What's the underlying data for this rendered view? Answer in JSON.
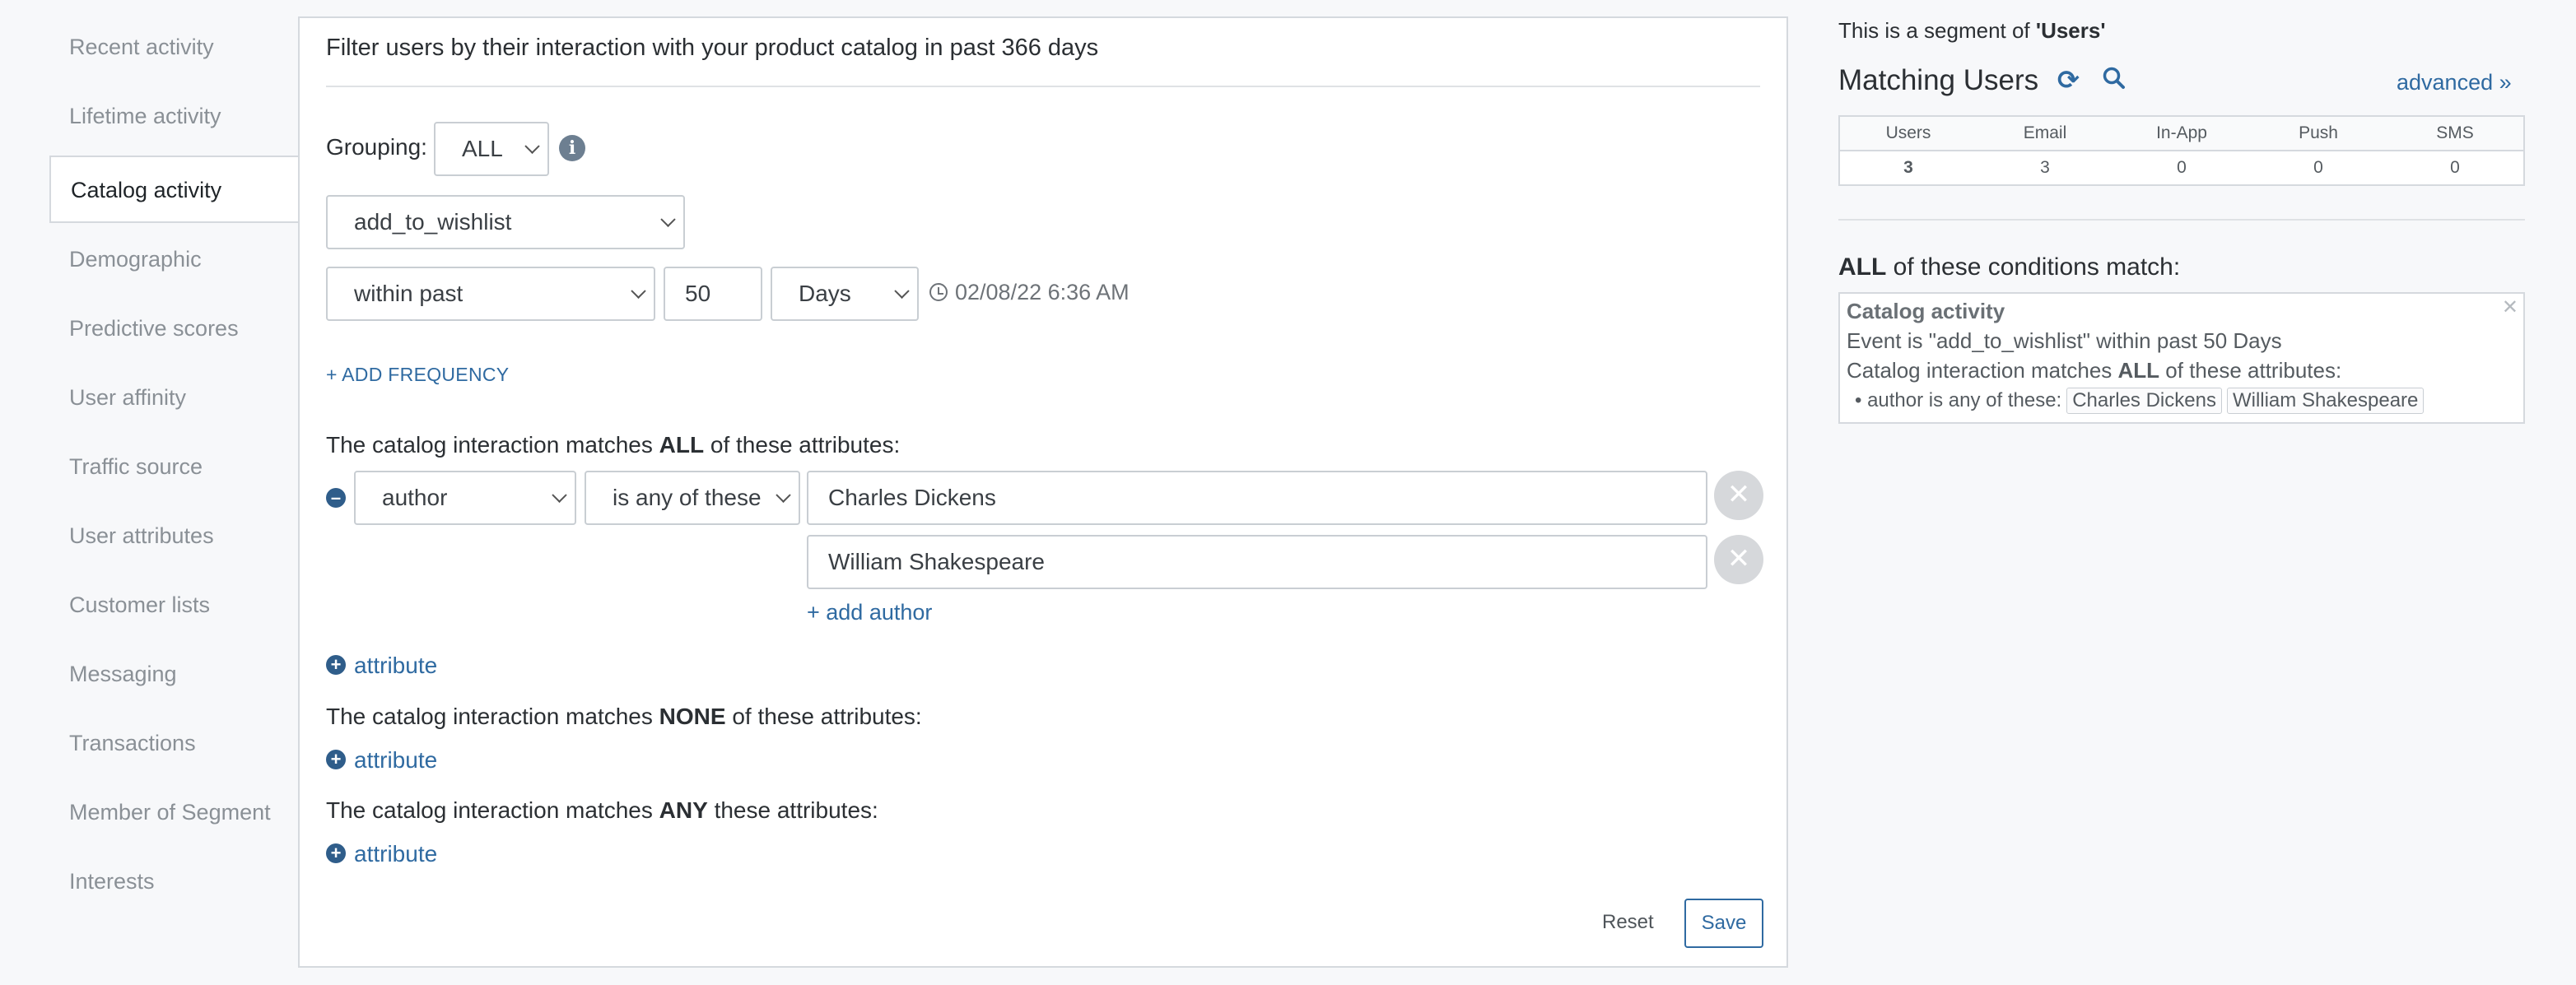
{
  "sidebar": {
    "items": [
      {
        "label": "Recent activity",
        "active": false
      },
      {
        "label": "Lifetime activity",
        "active": false
      },
      {
        "label": "Catalog activity",
        "active": true
      },
      {
        "label": "Demographic",
        "active": false
      },
      {
        "label": "Predictive scores",
        "active": false
      },
      {
        "label": "User affinity",
        "active": false
      },
      {
        "label": "Traffic source",
        "active": false
      },
      {
        "label": "User attributes",
        "active": false
      },
      {
        "label": "Customer lists",
        "active": false
      },
      {
        "label": "Messaging",
        "active": false
      },
      {
        "label": "Transactions",
        "active": false
      },
      {
        "label": "Member of Segment",
        "active": false
      },
      {
        "label": "Interests",
        "active": false
      }
    ]
  },
  "main": {
    "heading": "Filter users by their interaction with your product catalog in past 366 days",
    "grouping_label": "Grouping:",
    "grouping_value": "ALL",
    "event_value": "add_to_wishlist",
    "time_operator": "within past",
    "time_amount": "50",
    "time_unit": "Days",
    "timestamp": "02/08/22 6:36 AM",
    "add_frequency": "+ ADD FREQUENCY",
    "all_section": {
      "prefix": "The catalog interaction matches ",
      "keyword": "ALL",
      "suffix": " of these attributes:"
    },
    "attribute_row": {
      "attribute": "author",
      "operator": "is any of these",
      "values": [
        "Charles Dickens",
        "William Shakespeare"
      ],
      "add_value": "+ add author"
    },
    "add_attribute_label": "attribute",
    "none_section": {
      "prefix": "The catalog interaction matches ",
      "keyword": "NONE",
      "suffix": " of these attributes:"
    },
    "any_section": {
      "prefix": "The catalog interaction matches ",
      "keyword": "ANY",
      "suffix": " these attributes:"
    },
    "reset_label": "Reset",
    "save_label": "Save"
  },
  "right": {
    "segment_prefix": "This is a segment of ",
    "segment_name": "'Users'",
    "matching_title": "Matching Users",
    "advanced_link": "advanced »",
    "stats": {
      "headers": [
        "Users",
        "Email",
        "In-App",
        "Push",
        "SMS"
      ],
      "values": [
        "3",
        "3",
        "0",
        "0",
        "0"
      ]
    },
    "conditions_keyword": "ALL",
    "conditions_suffix": " of these conditions match:",
    "condition": {
      "title": "Catalog activity",
      "line1": "Event is \"add_to_wishlist\" within past 50 Days",
      "line2_prefix": "Catalog interaction matches ",
      "line2_keyword": "ALL",
      "line2_suffix": " of these attributes:",
      "line3_prefix": "• author is any of these:",
      "tags": [
        "Charles Dickens",
        "William Shakespeare"
      ]
    }
  },
  "icons": {
    "info": "info-icon",
    "clock": "clock-icon",
    "remove": "remove-icon",
    "add": "plus-circle-icon",
    "minus": "minus-circle-icon",
    "refresh": "refresh-icon",
    "search": "search-icon",
    "close": "close-icon"
  },
  "colors": {
    "link": "#2f6aa1",
    "icon_dark": "#2f5d8a",
    "border": "#d5d9de"
  }
}
